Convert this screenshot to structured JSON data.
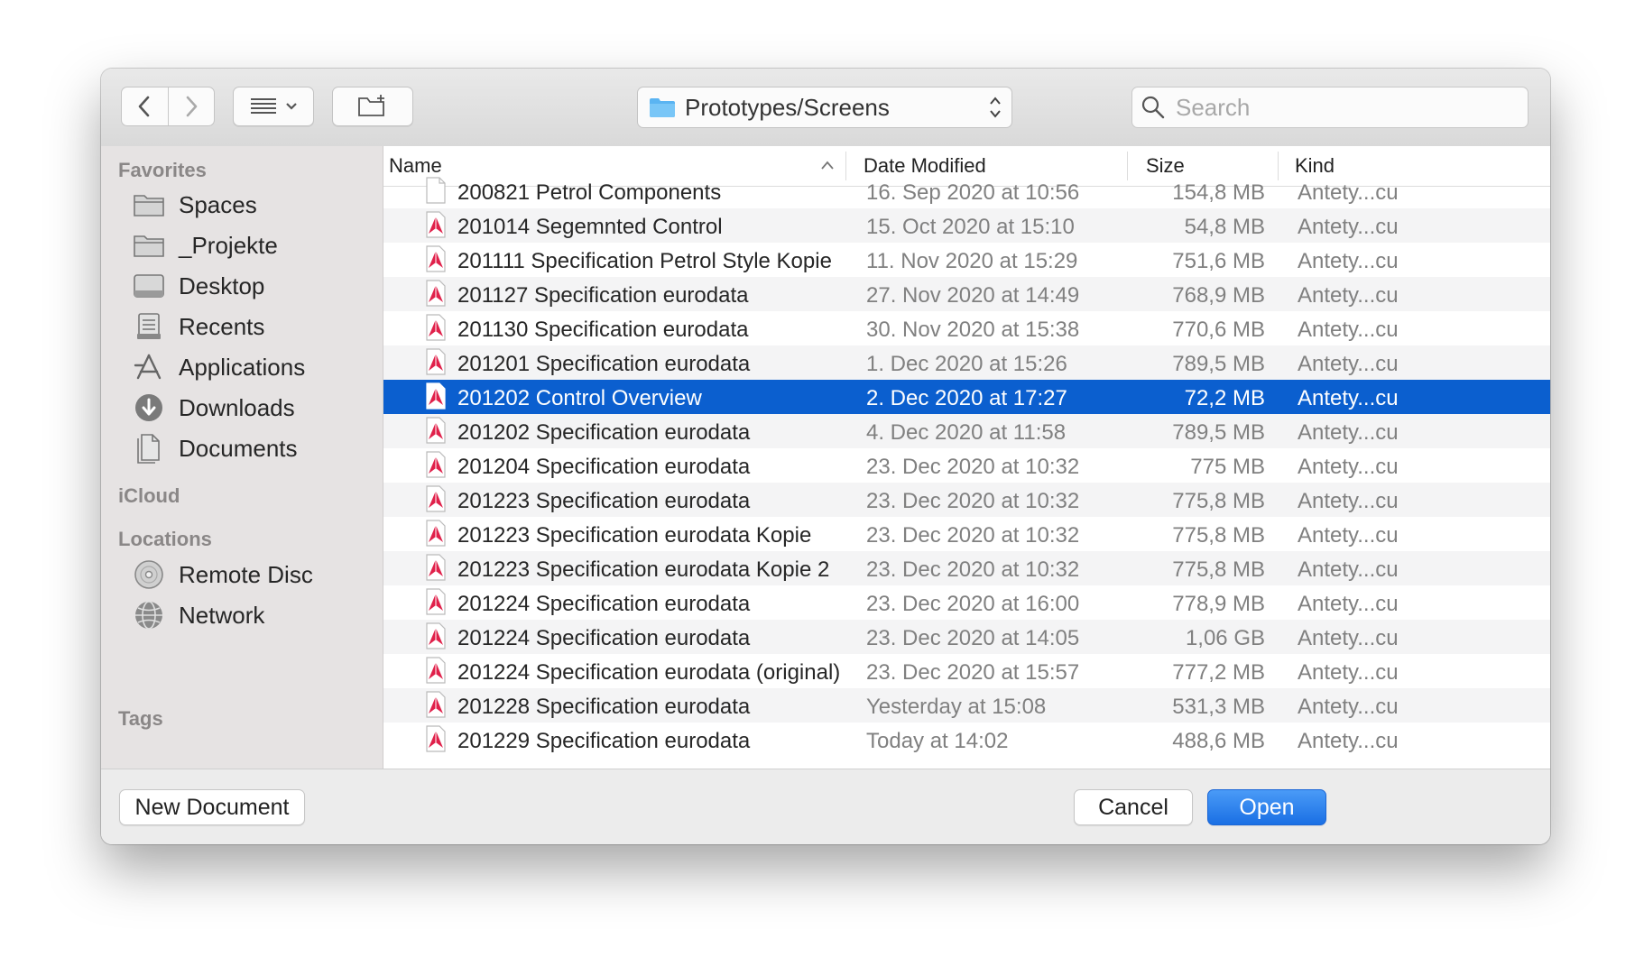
{
  "toolbar": {
    "back_label": "",
    "forward_label": "",
    "path": "Prototypes/Screens",
    "search_placeholder": "Search"
  },
  "sidebar": {
    "favorites_header": "Favorites",
    "favorites": [
      {
        "label": "Spaces",
        "icon": "folder-icon"
      },
      {
        "label": "_Projekte",
        "icon": "folder-icon"
      },
      {
        "label": "Desktop",
        "icon": "desktop-icon"
      },
      {
        "label": "Recents",
        "icon": "recents-icon"
      },
      {
        "label": "Applications",
        "icon": "applications-icon"
      },
      {
        "label": "Downloads",
        "icon": "downloads-icon"
      },
      {
        "label": "Documents",
        "icon": "documents-icon"
      }
    ],
    "icloud_header": "iCloud",
    "locations_header": "Locations",
    "locations": [
      {
        "label": "Remote Disc",
        "icon": "disc-icon"
      },
      {
        "label": "Network",
        "icon": "network-icon"
      }
    ],
    "tags_header": "Tags"
  },
  "columns": {
    "name": "Name",
    "date": "Date Modified",
    "size": "Size",
    "kind": "Kind"
  },
  "files": [
    {
      "name": "200821 Petrol Components",
      "date": "16. Sep 2020 at 10:56",
      "size": "154,8 MB",
      "kind": "Antety...cu",
      "icon": "blank-document-icon"
    },
    {
      "name": "201014 Segemnted Control",
      "date": "15. Oct 2020 at 15:10",
      "size": "54,8 MB",
      "kind": "Antety...cu",
      "icon": "sketch-file-icon"
    },
    {
      "name": "201111 Specification Petrol Style Kopie",
      "date": "11. Nov 2020 at 15:29",
      "size": "751,6 MB",
      "kind": "Antety...cu",
      "icon": "sketch-file-icon"
    },
    {
      "name": "201127 Specification eurodata",
      "date": "27. Nov 2020 at 14:49",
      "size": "768,9 MB",
      "kind": "Antety...cu",
      "icon": "sketch-file-icon"
    },
    {
      "name": "201130 Specification eurodata",
      "date": "30. Nov 2020 at 15:38",
      "size": "770,6 MB",
      "kind": "Antety...cu",
      "icon": "sketch-file-icon"
    },
    {
      "name": "201201 Specification eurodata",
      "date": "1. Dec 2020 at 15:26",
      "size": "789,5 MB",
      "kind": "Antety...cu",
      "icon": "sketch-file-icon"
    },
    {
      "name": "201202 Control Overview",
      "date": "2. Dec 2020 at 17:27",
      "size": "72,2 MB",
      "kind": "Antety...cu",
      "icon": "sketch-file-icon",
      "selected": true
    },
    {
      "name": "201202 Specification eurodata",
      "date": "4. Dec 2020 at 11:58",
      "size": "789,5 MB",
      "kind": "Antety...cu",
      "icon": "sketch-file-icon"
    },
    {
      "name": "201204 Specification eurodata",
      "date": "23. Dec 2020 at 10:32",
      "size": "775 MB",
      "kind": "Antety...cu",
      "icon": "sketch-file-icon"
    },
    {
      "name": "201223 Specification eurodata",
      "date": "23. Dec 2020 at 10:32",
      "size": "775,8 MB",
      "kind": "Antety...cu",
      "icon": "sketch-file-icon"
    },
    {
      "name": "201223 Specification eurodata Kopie",
      "date": "23. Dec 2020 at 10:32",
      "size": "775,8 MB",
      "kind": "Antety...cu",
      "icon": "sketch-file-icon"
    },
    {
      "name": "201223 Specification eurodata Kopie 2",
      "date": "23. Dec 2020 at 10:32",
      "size": "775,8 MB",
      "kind": "Antety...cu",
      "icon": "sketch-file-icon"
    },
    {
      "name": "201224 Specification eurodata",
      "date": "23. Dec 2020 at 16:00",
      "size": "778,9 MB",
      "kind": "Antety...cu",
      "icon": "sketch-file-icon"
    },
    {
      "name": "201224 Specification eurodata",
      "date": "23. Dec 2020 at 14:05",
      "size": "1,06 GB",
      "kind": "Antety...cu",
      "icon": "sketch-file-icon"
    },
    {
      "name": "201224 Specification eurodata  (original)",
      "date": "23. Dec 2020 at 15:57",
      "size": "777,2 MB",
      "kind": "Antety...cu",
      "icon": "sketch-file-icon"
    },
    {
      "name": "201228 Specification eurodata",
      "date": "Yesterday at 15:08",
      "size": "531,3 MB",
      "kind": "Antety...cu",
      "icon": "sketch-file-icon"
    },
    {
      "name": "201229 Specification eurodata",
      "date": "Today at 14:02",
      "size": "488,6 MB",
      "kind": "Antety...cu",
      "icon": "sketch-file-icon"
    }
  ],
  "buttons": {
    "new_document": "New Document",
    "cancel": "Cancel",
    "open": "Open"
  },
  "colors": {
    "selection": "#0b5fcf",
    "primary_button": "#1a6fe4",
    "sketch_icon": "#e0204a"
  }
}
